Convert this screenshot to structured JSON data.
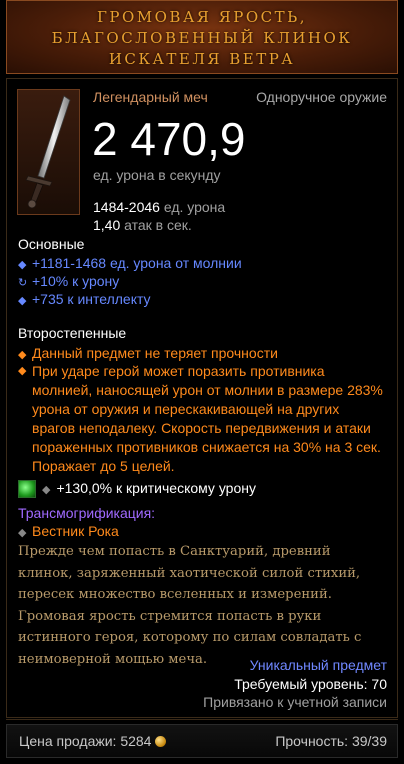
{
  "header": {
    "lines": [
      "ГРОМОВАЯ ЯРОСТЬ,",
      "БЛАГОСЛОВЕННЫЙ КЛИНОК",
      "ИСКАТЕЛЯ ВЕТРА"
    ]
  },
  "item": {
    "icon": "legendary-sword-icon",
    "type_left": "Легендарный меч",
    "type_right": "Одноручное оружие",
    "dps": "2 470,9",
    "dps_label": "ед. урона в секунду",
    "damage_value": "1484-2046",
    "damage_label": "ед. урона",
    "speed_value": "1,40",
    "speed_label": "атак в сек."
  },
  "primary": {
    "heading": "Основные",
    "props": [
      "+1181-1468 ед. урона от молнии",
      "+10% к урону",
      "+735 к интеллекту"
    ]
  },
  "secondary": {
    "heading": "Второстепенные",
    "props": [
      "Данный предмет не теряет прочности",
      "При ударе герой может поразить противника молнией, наносящей урон от молнии в размере 283% урона от оружия и перескакивающей на других врагов неподалеку. Скорость передвижения и атаки пораженных противников снижается на 30% на 3 сек. Поражает до 5 целей."
    ]
  },
  "socket": {
    "gem_icon": "emerald-gem-icon",
    "text": "+130,0% к критическому урону"
  },
  "transmog": {
    "heading": "Трансмогрификация:",
    "value": "Вестник Рока"
  },
  "flavor": "Прежде чем попасть в Санктуарий, древний клинок, заряженный хаотической силой стихий, пересек множество вселенных и измерений. Громовая ярость стремится попасть в руки истинного героя, которому по силам совладать с неимоверной мощью меча.",
  "footer_meta": {
    "unique": "Уникальный предмет",
    "required_level": "Требуемый уровень: 70",
    "bound": "Привязано к учетной записи"
  },
  "footer": {
    "price_label": "Цена продажи:",
    "price_value": "5284",
    "durability_label": "Прочность:",
    "durability_value": "39/39"
  },
  "colors": {
    "header_gold": "#e8a030",
    "magic_blue": "#6688ff",
    "legendary_orange": "#ff8a1c",
    "transmog_purple": "#a06aff",
    "flavor_tan": "#b89a6a"
  }
}
